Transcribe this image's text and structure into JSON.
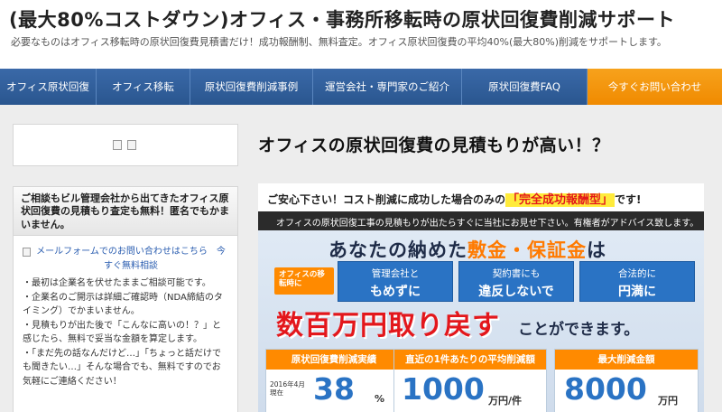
{
  "header": {
    "title": "(最大80%コストダウン)オフィス・事務所移転時の原状回復費削減サポート",
    "description": "必要なものはオフィス移転時の原状回復費見積書だけ！成功報酬制、無料査定。オフィス原状回復費の平均40%(最大80%)削減をサポートします。"
  },
  "nav": {
    "items": [
      {
        "label": "オフィス原状回復"
      },
      {
        "label": "オフィス移転"
      },
      {
        "label": "原状回復費削減事例"
      },
      {
        "label": "運営会社・専門家のご紹介"
      },
      {
        "label": "原状回復費FAQ"
      },
      {
        "label": "今すぐお問い合わせ"
      }
    ],
    "cta_color": "#f08a00",
    "bar_color": "#2e5d9a"
  },
  "sidebar": {
    "contact_heading": "ご相談もビル管理会社から出てきたオフィス原状回復費の見積もり査定も無料！匿名でもかまいません。",
    "contact_link": "メールフォームでのお問い合わせはこちら　今すぐ無料相談",
    "bullets": [
      "・最初は企業名を伏せたままご相談可能です。",
      "・企業名のご開示は詳細ご確認時（NDA締結のタイミング）でかまいません。",
      "・見積もりが出た後で「こんなに高いの！？」と感じたら、無料で妥当な金額を算定します。",
      "・「まだ先の話なんだけど…」「ちょっと話だけでも聞きたい…」そんな場合でも、無料ですのでお気軽にご連絡ください！"
    ]
  },
  "main": {
    "title": "オフィスの原状回復費の見積もりが高い！？"
  },
  "banner": {
    "top_text": "ご安心下さい！コスト削減に成功した場合のみの",
    "top_highlight": "「完全成功報酬型」",
    "top_suffix": "です!",
    "strip_text": "オフィスの原状回復工事の見積もりが出たらすぐに当社にお見せ下さい。有権者がアドバイス致します。",
    "big_prefix": "あなたの納めた",
    "big_highlight": "敷金・保証金",
    "big_suffix": "は",
    "tag": "オフィスの移転時に",
    "boxes": [
      {
        "line1": "管理会社と",
        "line2": "もめずに"
      },
      {
        "line1": "契約書にも",
        "line2": "違反しないで"
      },
      {
        "line1": "合法的に",
        "line2": "円満に"
      }
    ],
    "red_text": "数百万円取り戻す",
    "red_tail": "ことができます。",
    "stats": [
      {
        "head": "原状回復費削減実績",
        "note": "2016年4月\n現在",
        "value": "38",
        "unit": "%"
      },
      {
        "head": "直近の1件あたりの平均削減額",
        "note": "",
        "value": "1000",
        "unit": "万円/件"
      },
      {
        "head": "最大削減金額",
        "note": "",
        "value": "8000",
        "unit": "万円"
      }
    ]
  }
}
